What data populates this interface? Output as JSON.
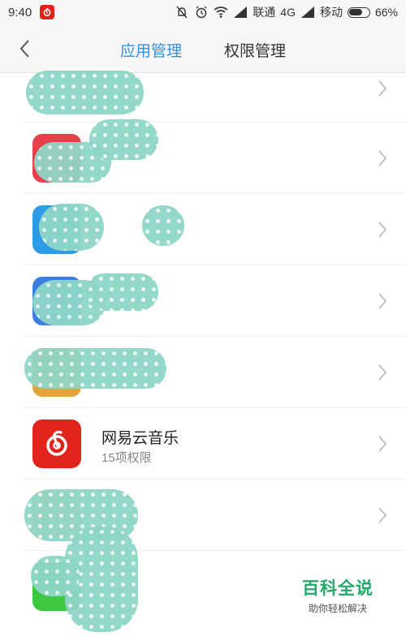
{
  "status_bar": {
    "time": "9:40",
    "carrier1": "联通",
    "network1": "4G",
    "carrier2": "移动",
    "battery_text": "66%",
    "battery_level": 0.66,
    "icons": [
      "netease-music-icon",
      "mute-bell-icon",
      "alarm-icon",
      "wifi-icon",
      "signal-icon",
      "signal-icon",
      "battery-icon"
    ]
  },
  "header": {
    "tabs": [
      {
        "label": "应用管理",
        "active": true
      },
      {
        "label": "权限管理",
        "active": false
      }
    ]
  },
  "list": {
    "featured_app": {
      "name": "网易云音乐",
      "permission_count": "15项权限",
      "icon_color": "#e0241c"
    }
  },
  "watermark": {
    "title": "百科全说",
    "subtitle": "助你轻松解决",
    "color": "#23a86a"
  },
  "colors": {
    "accent": "#2f92e8",
    "obfuscation": "#8fd6c8"
  }
}
